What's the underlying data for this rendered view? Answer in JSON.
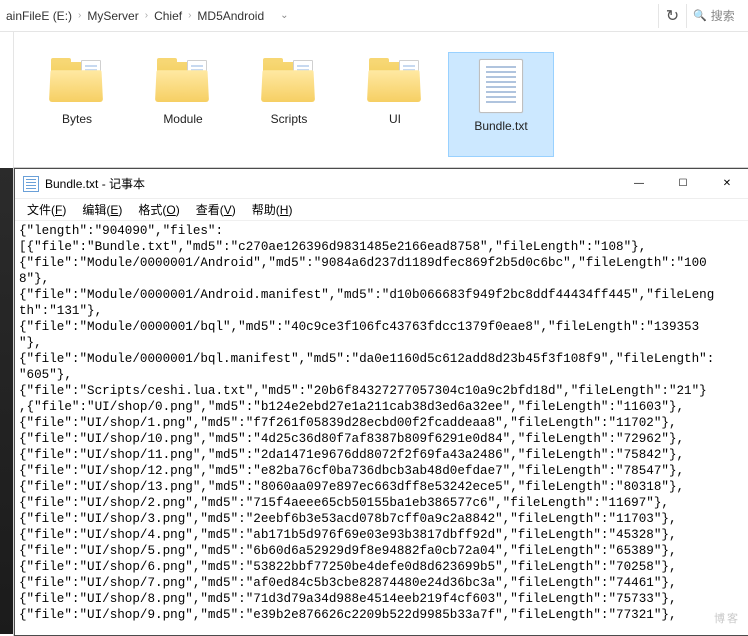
{
  "breadcrumb": {
    "items": [
      "ainFileE (E:)",
      "MyServer",
      "Chief",
      "MD5Android"
    ],
    "refresh_icon": "↻",
    "search_placeholder": "搜索"
  },
  "files": {
    "folders": [
      {
        "name": "Bytes"
      },
      {
        "name": "Module"
      },
      {
        "name": "Scripts"
      },
      {
        "name": "UI"
      }
    ],
    "selected_file": "Bundle.txt"
  },
  "notepad": {
    "title": "Bundle.txt - 记事本",
    "win": {
      "min": "—",
      "max": "☐",
      "close": "✕"
    },
    "menu": {
      "file": {
        "label": "文件",
        "key": "F"
      },
      "edit": {
        "label": "编辑",
        "key": "E"
      },
      "format": {
        "label": "格式",
        "key": "O"
      },
      "view": {
        "label": "查看",
        "key": "V"
      },
      "help": {
        "label": "帮助",
        "key": "H"
      }
    },
    "content": "{\"length\":\"904090\",\"files\":\n[{\"file\":\"Bundle.txt\",\"md5\":\"c270ae126396d9831485e2166ead8758\",\"fileLength\":\"108\"},\n{\"file\":\"Module/0000001/Android\",\"md5\":\"9084a6d237d1189dfec869f2b5d0c6bc\",\"fileLength\":\"100\n8\"},\n{\"file\":\"Module/0000001/Android.manifest\",\"md5\":\"d10b066683f949f2bc8ddf44434ff445\",\"fileLeng\nth\":\"131\"},\n{\"file\":\"Module/0000001/bql\",\"md5\":\"40c9ce3f106fc43763fdcc1379f0eae8\",\"fileLength\":\"139353\n\"},\n{\"file\":\"Module/0000001/bql.manifest\",\"md5\":\"da0e1160d5c612add8d23b45f3f108f9\",\"fileLength\":\n\"605\"},\n{\"file\":\"Scripts/ceshi.lua.txt\",\"md5\":\"20b6f84327277057304c10a9c2bfd18d\",\"fileLength\":\"21\"}\n,{\"file\":\"UI/shop/0.png\",\"md5\":\"b124e2ebd27e1a211cab38d3ed6a32ee\",\"fileLength\":\"11603\"},\n{\"file\":\"UI/shop/1.png\",\"md5\":\"f7f261f05839d28ecbd00f2fcaddeaa8\",\"fileLength\":\"11702\"},\n{\"file\":\"UI/shop/10.png\",\"md5\":\"4d25c36d80f7af8387b809f6291e0d84\",\"fileLength\":\"72962\"},\n{\"file\":\"UI/shop/11.png\",\"md5\":\"2da1471e9676dd8072f2f69fa43a2486\",\"fileLength\":\"75842\"},\n{\"file\":\"UI/shop/12.png\",\"md5\":\"e82ba76cf0ba736dbcb3ab48d0efdae7\",\"fileLength\":\"78547\"},\n{\"file\":\"UI/shop/13.png\",\"md5\":\"8060aa097e897ec663dff8e53242ece5\",\"fileLength\":\"80318\"},\n{\"file\":\"UI/shop/2.png\",\"md5\":\"715f4aeee65cb50155ba1eb386577c6\",\"fileLength\":\"11697\"},\n{\"file\":\"UI/shop/3.png\",\"md5\":\"2eebf6b3e53acd078b7cff0a9c2a8842\",\"fileLength\":\"11703\"},\n{\"file\":\"UI/shop/4.png\",\"md5\":\"ab171b5d976f69e03e93b3817dbff92d\",\"fileLength\":\"45328\"},\n{\"file\":\"UI/shop/5.png\",\"md5\":\"6b60d6a52929d9f8e94882fa0cb72a04\",\"fileLength\":\"65389\"},\n{\"file\":\"UI/shop/6.png\",\"md5\":\"53822bbf77250be4defe0d8d623699b5\",\"fileLength\":\"70258\"},\n{\"file\":\"UI/shop/7.png\",\"md5\":\"af0ed84c5b3cbe82874480e24d36bc3a\",\"fileLength\":\"74461\"},\n{\"file\":\"UI/shop/8.png\",\"md5\":\"71d3d79a34d988e4514eeb219f4cf603\",\"fileLength\":\"75733\"},\n{\"file\":\"UI/shop/9.png\",\"md5\":\"e39b2e876626c2209b522d9985b33a7f\",\"fileLength\":\"77321\"},"
  },
  "watermark": "博客"
}
